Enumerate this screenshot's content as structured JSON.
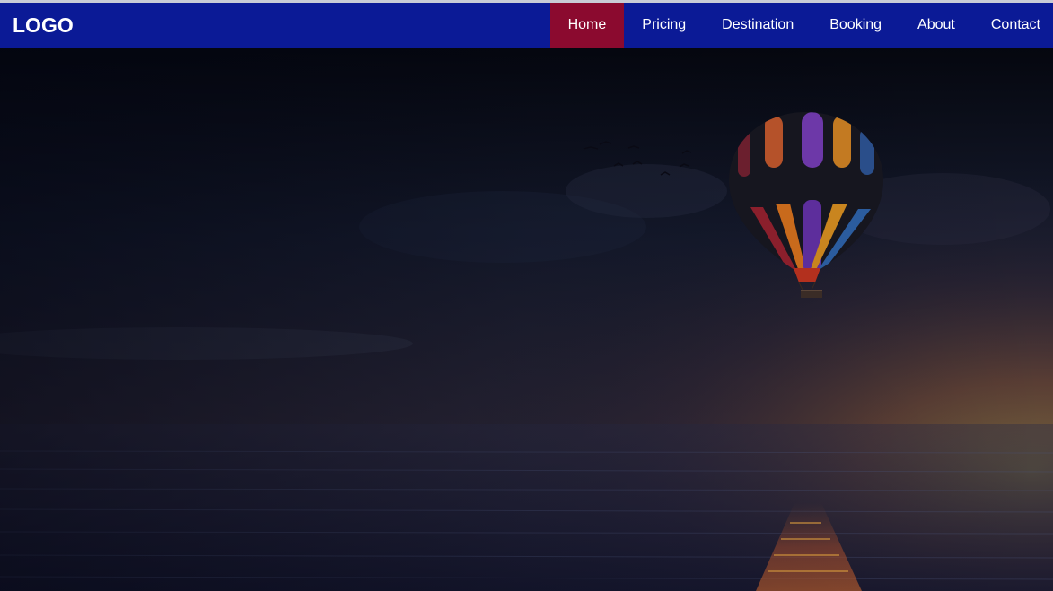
{
  "header": {
    "logo": "LOGO",
    "nav": [
      {
        "label": "Home",
        "active": true
      },
      {
        "label": "Pricing",
        "active": false
      },
      {
        "label": "Destination",
        "active": false
      },
      {
        "label": "Booking",
        "active": false
      },
      {
        "label": "About",
        "active": false
      },
      {
        "label": "Contact",
        "active": false
      }
    ]
  },
  "colors": {
    "navbar": "#0b1a96",
    "active_nav": "#8b0a2f",
    "text": "#ffffff"
  },
  "hero": {
    "image": "hot-air-balloon-over-water-at-dusk"
  }
}
